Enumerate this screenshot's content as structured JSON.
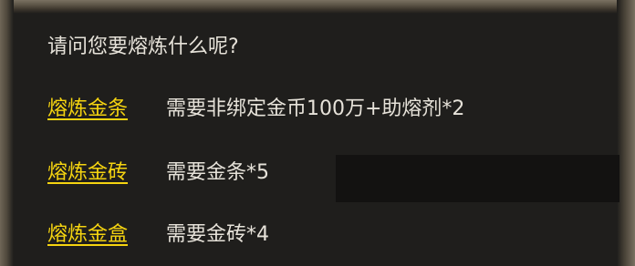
{
  "dialog": {
    "prompt": "请问您要熔炼什么呢?",
    "options": [
      {
        "link": "熔炼金条",
        "requirement": "需要非绑定金币100万+助熔剂*2"
      },
      {
        "link": "熔炼金砖",
        "requirement": "需要金条*5"
      },
      {
        "link": "熔炼金盒",
        "requirement": "需要金砖*4"
      }
    ]
  },
  "colors": {
    "link": "#f5d410",
    "text": "#e6e2d9",
    "background": "#1f1e1c"
  }
}
